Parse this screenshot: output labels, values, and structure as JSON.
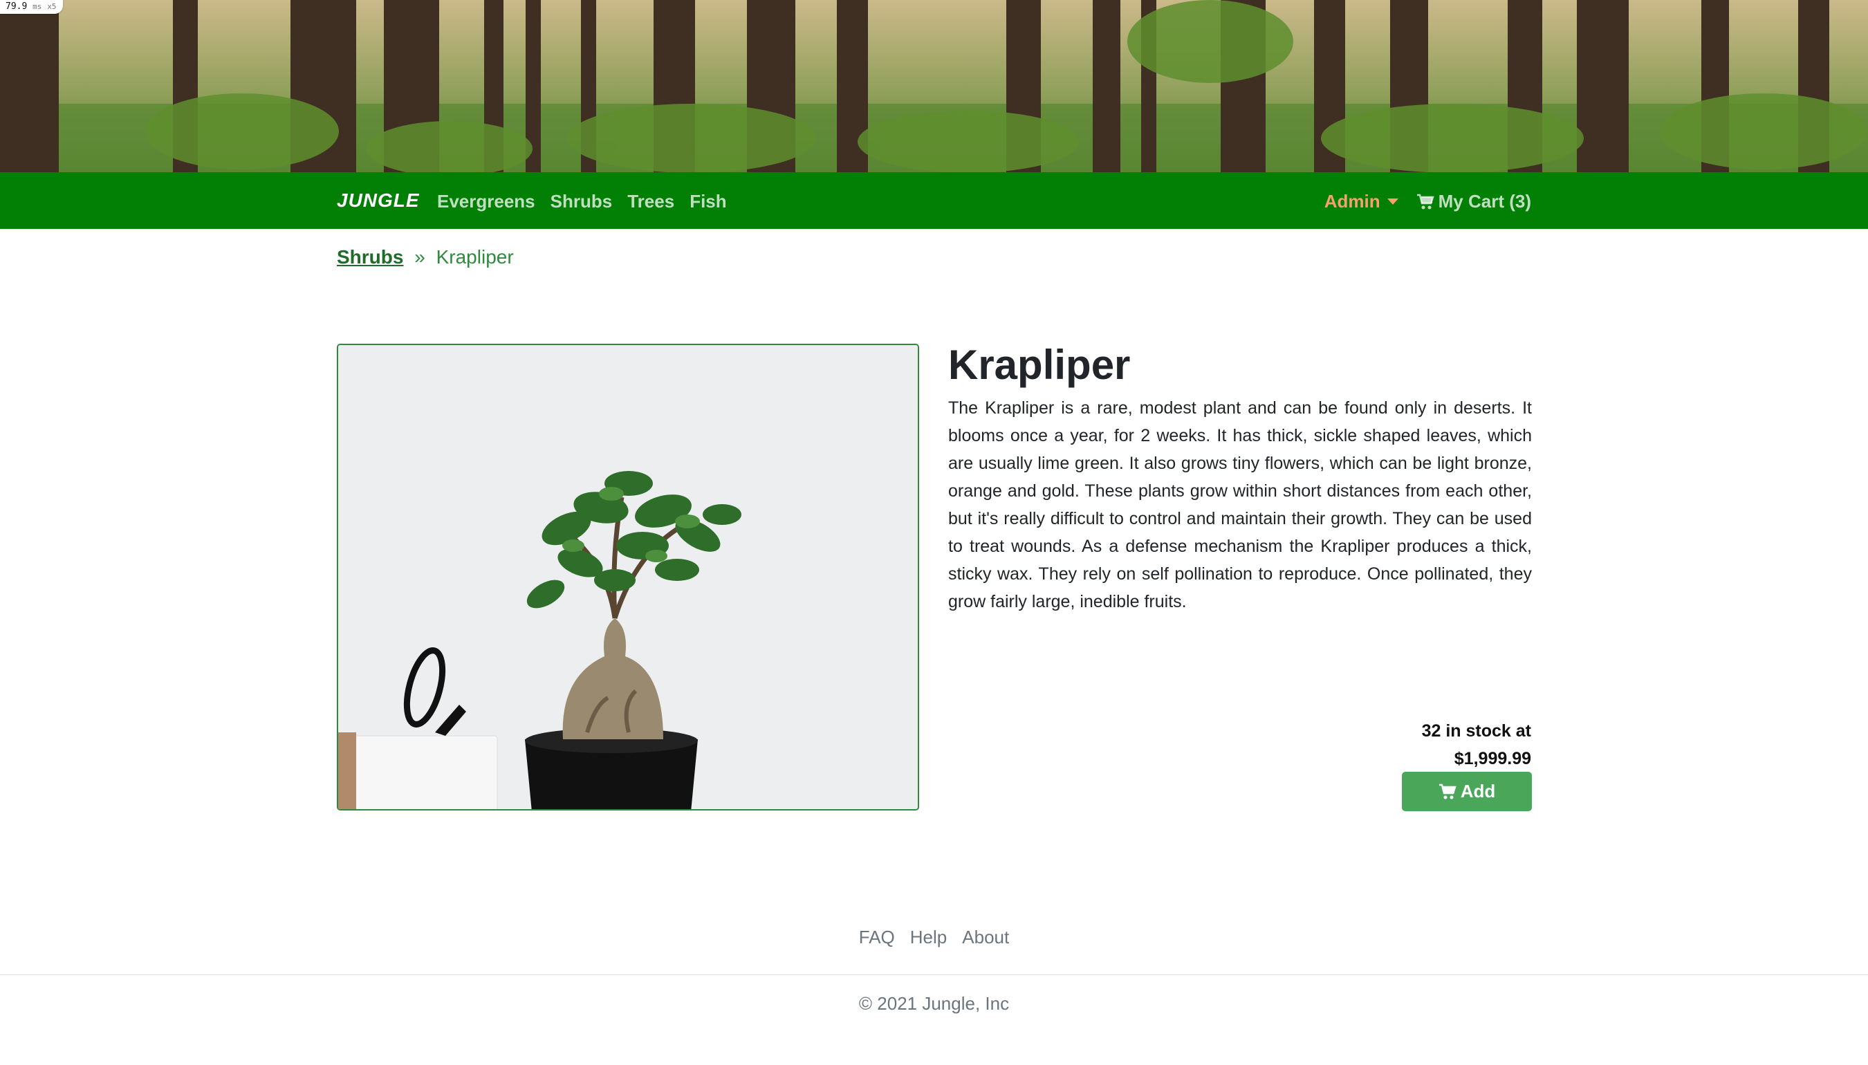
{
  "perf_badge": {
    "value": "79.9",
    "unit": "ms",
    "suffix": "x5"
  },
  "nav": {
    "brand": "JUNGLE",
    "links": [
      "Evergreens",
      "Shrubs",
      "Trees",
      "Fish"
    ],
    "admin": "Admin",
    "cart_label": "My Cart (3)"
  },
  "breadcrumb": {
    "parent": "Shrubs",
    "separator": "»",
    "current": "Krapliper"
  },
  "product": {
    "name": "Krapliper",
    "description": "The Krapliper is a rare, modest plant and can be found only in deserts. It blooms once a year, for 2 weeks. It has thick, sickle shaped leaves, which are usually lime green. It also grows tiny flowers, which can be light bronze, orange and gold. These plants grow within short distances from each other, but it's really difficult to control and maintain their growth. They can be used to treat wounds. As a defense mechanism the Krapliper produces a thick, sticky wax. They rely on self pollination to reproduce. Once pollinated, they grow fairly large, inedible fruits.",
    "stock_line": "32 in stock at",
    "price": "$1,999.99",
    "add_label": "Add"
  },
  "footer": {
    "links": [
      "FAQ",
      "Help",
      "About"
    ],
    "copyright": "© 2021 Jungle, Inc"
  },
  "colors": {
    "nav_bg": "#028005",
    "admin": "#f7a070",
    "add_button": "#4aa75a",
    "image_border": "#2e8b3e"
  },
  "icons": {
    "cart": "shopping-cart-icon",
    "admin_toggle": "caret-down-icon"
  }
}
